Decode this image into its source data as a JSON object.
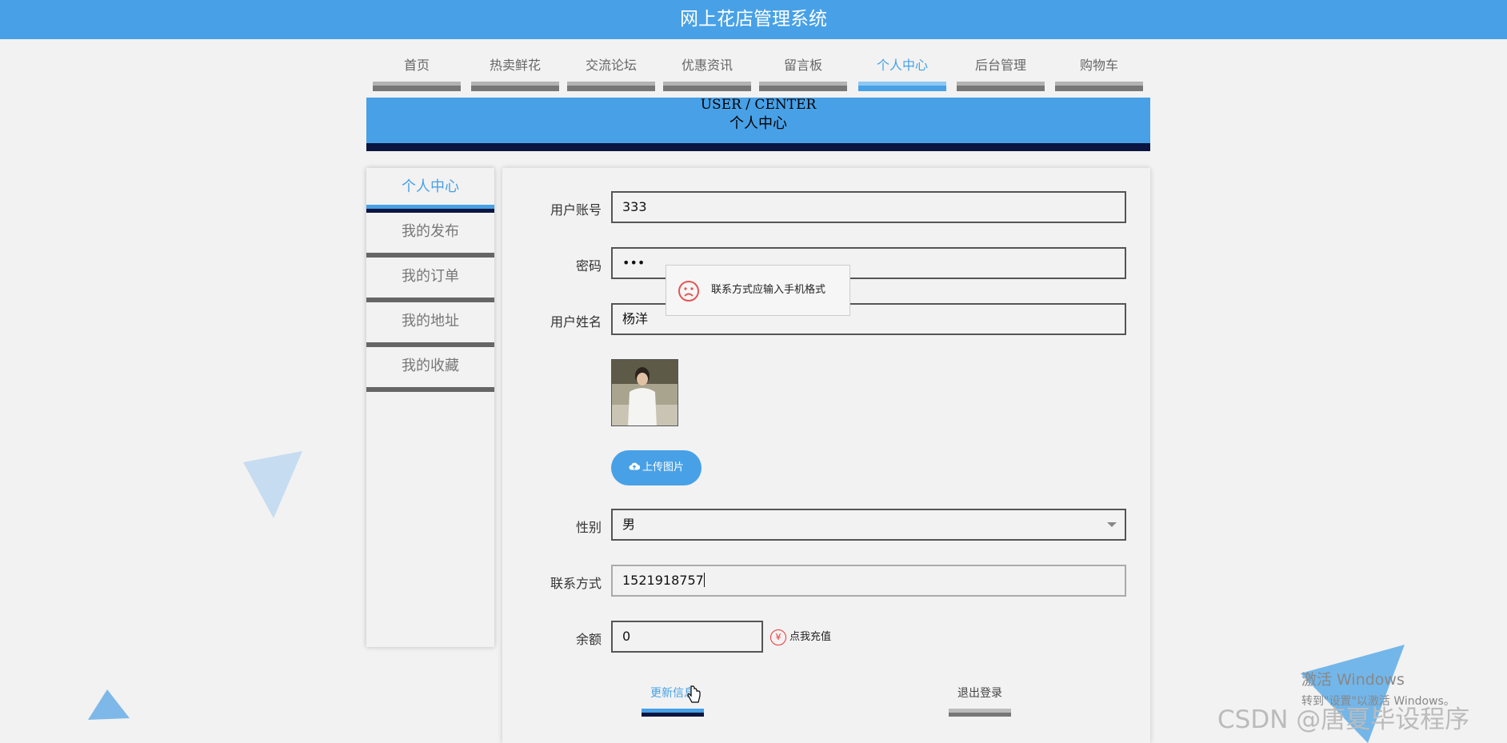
{
  "header": {
    "title": "网上花店管理系统"
  },
  "nav": {
    "items": [
      "首页",
      "热卖鲜花",
      "交流论坛",
      "优惠资讯",
      "留言板",
      "个人中心",
      "后台管理",
      "购物车"
    ],
    "active_index": 5
  },
  "banner": {
    "en": "USER / CENTER",
    "cn": "个人中心"
  },
  "sidebar": {
    "items": [
      "个人中心",
      "我的发布",
      "我的订单",
      "我的地址",
      "我的收藏"
    ],
    "active_index": 0
  },
  "form": {
    "account_label": "用户账号",
    "account_value": "333",
    "password_label": "密码",
    "password_value": "•••",
    "name_label": "用户姓名",
    "name_value": "杨洋",
    "upload_label": "上传图片",
    "gender_label": "性别",
    "gender_value": "男",
    "phone_label": "联系方式",
    "phone_value": "1521918757",
    "balance_label": "余额",
    "balance_value": "0",
    "recharge_label": "点我充值",
    "recharge_icon": "¥"
  },
  "tooltip": {
    "text": "联系方式应输入手机格式"
  },
  "actions": {
    "update_label": "更新信息",
    "logout_label": "退出登录"
  },
  "watermark": {
    "windows_title": "激活 Windows",
    "windows_sub": "转到\"设置\"以激活 Windows。",
    "csdn": "CSDN @唐夏毕设程序"
  },
  "colors": {
    "accent": "#48a1e6",
    "dark_bar": "#0b1640",
    "error": "#e55555"
  }
}
